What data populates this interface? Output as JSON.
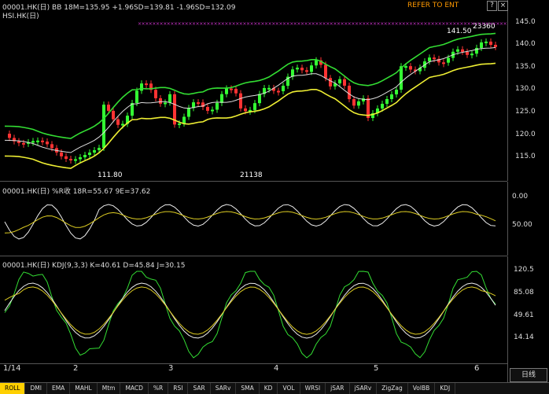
{
  "main": {
    "header_bb": "00001.HK(日) BB 18M=135.95 +1.96SD=139.81 -1.96SD=132.09",
    "header_hsi": "HSI.HK(日)",
    "refer": "REFER TO ENT",
    "y_ticks": [
      "145.0",
      "140.0",
      "135.0",
      "130.0",
      "125.0",
      "120.0",
      "115.0"
    ],
    "annotations": {
      "low": "111.80",
      "high": "141.50",
      "hsi_high": "23360",
      "hsi_low": "21138"
    }
  },
  "rsi": {
    "header": "00001.HK(日) %R收 18R=55.67 9E=37.62",
    "y_ticks": [
      "0.00",
      "50.00"
    ]
  },
  "kdj": {
    "header": "00001.HK(日) KDJ(9,3,3) K=40.61 D=45.84 J=30.15",
    "y_ticks": [
      "120.5",
      "85.08",
      "49.61",
      "14.14"
    ]
  },
  "x_labels": [
    "1/14",
    "2",
    "3",
    "4",
    "5",
    "6"
  ],
  "timeframe": "日线",
  "tabs": [
    "ROLL",
    "DMI",
    "EMA",
    "MAHL",
    "Mtm",
    "MACD",
    "%R",
    "RSI",
    "SAR",
    "SARv",
    "SMA",
    "KD",
    "VOL",
    "WRSI",
    "jSAR",
    "jSARv",
    "ZigZag",
    "VolBB",
    "KDJ"
  ],
  "colors": {
    "up": "#33ff33",
    "down": "#ff3333",
    "bb_mid": "#dddddd",
    "bb_upper": "#33dd33",
    "bb_lower": "#eeee33",
    "accent": "#ffd000"
  }
}
